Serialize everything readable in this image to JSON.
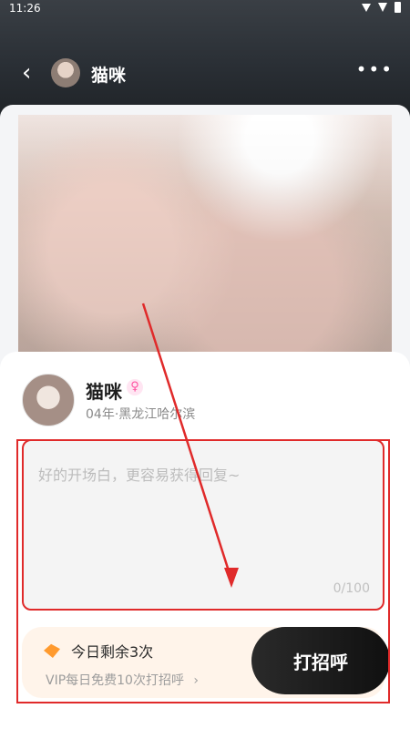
{
  "status": {
    "time": "11:26"
  },
  "header": {
    "back_icon": "back-icon",
    "title": "猫咪",
    "more_icon": "more-icon"
  },
  "profile": {
    "name": "猫咪",
    "gender_icon": "female-icon",
    "info": "04年·黑龙江哈尔滨"
  },
  "message": {
    "placeholder": "好的开场白，更容易获得回复~",
    "counter": "0/100"
  },
  "quota": {
    "remaining_text": "今日剩余3次",
    "vip_text": "VIP每日免费10次打招呼",
    "vip_chevron": "›"
  },
  "actions": {
    "greet_label": "打招呼"
  },
  "colors": {
    "accent_red": "#e02a2a",
    "vip_orange": "#ff9a2e",
    "button_dark": "#111111"
  }
}
